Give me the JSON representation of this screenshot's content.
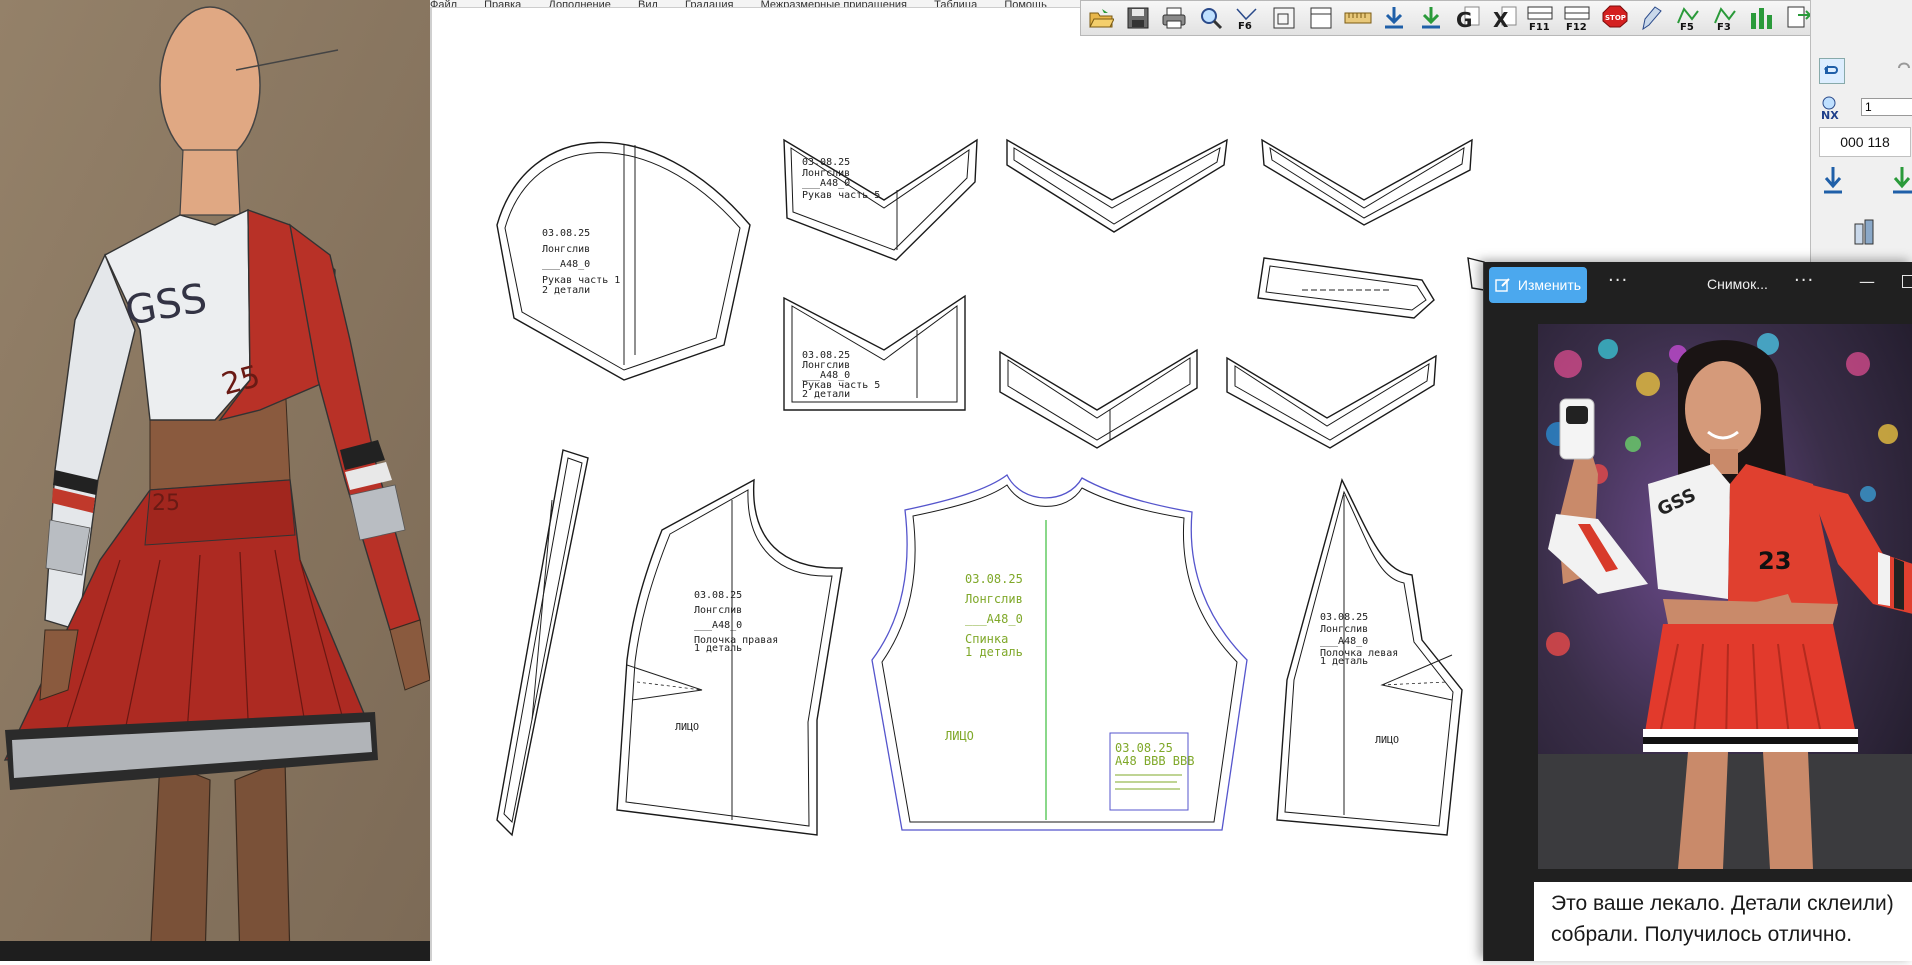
{
  "menu": [
    "Файл",
    "Правка",
    "Дополнение",
    "Вид",
    "Градация",
    "Межразмерные приращения",
    "Таблица",
    "Помощь"
  ],
  "toolbar_icons": [
    "open-folder-icon",
    "save-icon",
    "print-icon",
    "zoom-icon",
    "f6-icon",
    "fit-icon",
    "frame-icon",
    "ruler-icon",
    "download-icon",
    "download-green-icon",
    "g-icon",
    "x-icon",
    "f11-icon",
    "f12-icon",
    "stop-icon",
    "pen-icon",
    "f5-icon",
    "f3-icon",
    "bars-icon",
    "export-icon"
  ],
  "toolbar_labels": {
    "f6": "F6",
    "f11": "F11",
    "f12": "F12",
    "f5": "F5",
    "f3": "F3",
    "stop": "STOP"
  },
  "panel": {
    "nx_label": "NX",
    "nx_value": "1",
    "number": "000 118"
  },
  "patterns": {
    "sleeve": {
      "lines": [
        "03.08.25",
        "Лонгслив",
        "___А48_0",
        "Рукав часть 1",
        "2 детали"
      ]
    },
    "cuff_left_top": {
      "lines": [
        "03.08.25",
        "Лонгслив",
        "___А48_0",
        "Рукав часть 5",
        "2 детали"
      ]
    },
    "cuff_left_bottom": {
      "lines": [
        "03.08.25",
        "Лонгслив",
        "___А48_0",
        "Рукав часть 5",
        "2 детали"
      ]
    },
    "front_left": {
      "lines": [
        "03.08.25",
        "Лонгслив",
        "___А48_0",
        "Полочка правая",
        "1 деталь"
      ],
      "face": "ЛИЦО"
    },
    "back": {
      "lines": [
        "03.08.25",
        "Лонгслив",
        "___А48_0",
        "Спинка",
        "1 деталь"
      ],
      "face": "ЛИЦО",
      "stamp": [
        "03.08.25",
        "А48 ВВВ ВВВ"
      ]
    },
    "front_right": {
      "lines": [
        "03.08.25",
        "Лонгслив",
        "___А48_0",
        "Полочка левая",
        "1 деталь"
      ],
      "face": "ЛИЦО"
    }
  },
  "sketch": {
    "logo": "GSS",
    "number": "25",
    "skirt_number": "25"
  },
  "viewer": {
    "edit_label": "Изменить",
    "more_icon": "···",
    "title": "Снимок...",
    "minimize": "—",
    "photo_shirt_logo": "GSS",
    "photo_shirt_number": "23",
    "caption_lines": [
      "Это ваше лекало. Детали склеили)",
      "собрали. Получилось отлично."
    ]
  },
  "colors": {
    "accent": "#4ba8ee",
    "pattern_green": "#7fa829",
    "pattern_blue": "#5555cc",
    "red": "#c8302a"
  }
}
